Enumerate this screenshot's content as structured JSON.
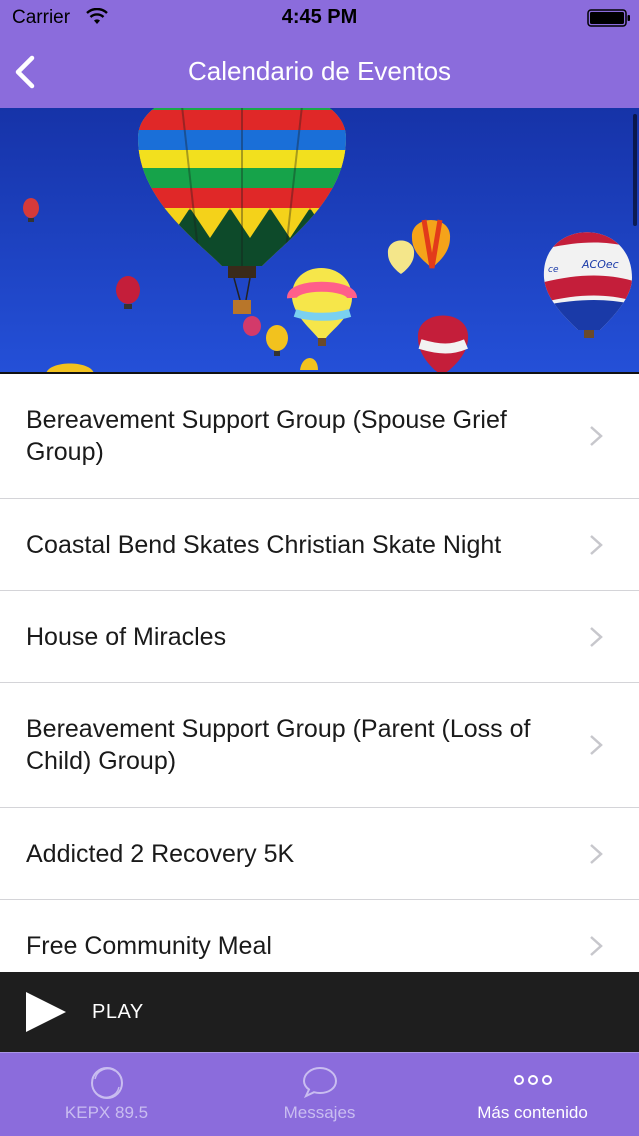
{
  "status_bar": {
    "carrier": "Carrier",
    "time": "4:45 PM"
  },
  "nav": {
    "title": "Calendario de Eventos",
    "back_icon": "chevron-left-icon"
  },
  "hero": {
    "image": "hot-air-balloons-photo"
  },
  "events": [
    {
      "label": "Bereavement Support Group (Spouse Grief Group)"
    },
    {
      "label": "Coastal Bend Skates Christian Skate Night"
    },
    {
      "label": "House of Miracles"
    },
    {
      "label": "Bereavement Support Group (Parent (Loss of Child) Group)"
    },
    {
      "label": "Addicted 2 Recovery 5K"
    },
    {
      "label": "Free Community Meal"
    }
  ],
  "player": {
    "label": "PLAY",
    "icon": "play-icon"
  },
  "tabs": [
    {
      "label": "KEPX 89.5",
      "icon": "radio-ring-icon"
    },
    {
      "label": "Messajes",
      "icon": "chat-bubble-icon"
    },
    {
      "label": "Más contenido",
      "icon": "more-dots-icon"
    }
  ],
  "colors": {
    "accent": "#8b6cdc",
    "player_bg": "#1e1e1e",
    "sky": "#1d3fc4"
  }
}
